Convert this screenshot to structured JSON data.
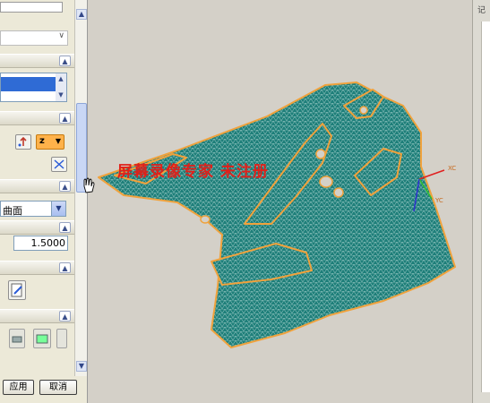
{
  "panel": {
    "combo_value": "曲面",
    "numeric_value": "1.5000",
    "tolerance_label": "z",
    "buttons": {
      "apply": "应用",
      "cancel": "取消"
    }
  },
  "viewport": {
    "watermark": "屏幕录像专家  未注册",
    "axis_x": "XC",
    "axis_y": "YC",
    "mesh_fill": "#1f7f7a",
    "mesh_edge": "#f0a23c"
  },
  "right_strip": {
    "header": "记"
  }
}
